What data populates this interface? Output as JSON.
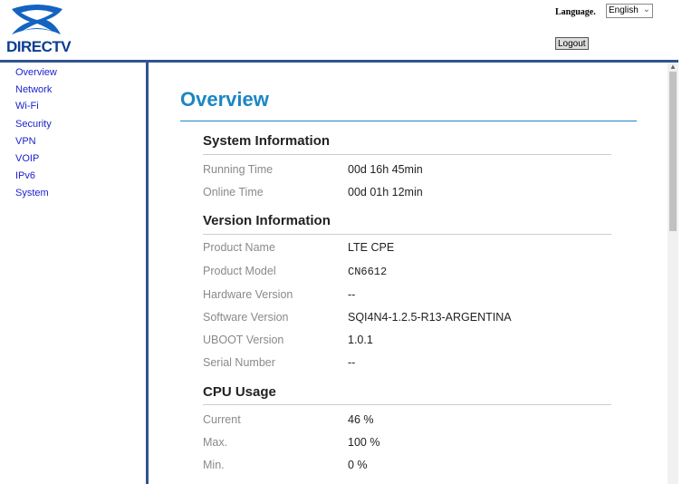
{
  "brand": {
    "logo_text": "DIRECTV"
  },
  "header": {
    "language_label": "Language.",
    "language_selected": "English",
    "logout_label": "Logout"
  },
  "sidebar": {
    "items": [
      {
        "label": "Overview"
      },
      {
        "label": "Network"
      },
      {
        "label": "Wi-Fi"
      },
      {
        "label": "Security"
      },
      {
        "label": "VPN"
      },
      {
        "label": "VOIP"
      },
      {
        "label": "IPv6"
      },
      {
        "label": "System"
      }
    ]
  },
  "main": {
    "title": "Overview",
    "sections": [
      {
        "title": "System Information",
        "rows": [
          {
            "label": "Running Time",
            "value": "00d 16h 45min"
          },
          {
            "label": "Online Time",
            "value": "00d 01h 12min"
          }
        ]
      },
      {
        "title": "Version Information",
        "rows": [
          {
            "label": "Product Name",
            "value": "LTE CPE"
          },
          {
            "label": "Product Model",
            "value": "CN6612"
          },
          {
            "label": "Hardware Version",
            "value": "--"
          },
          {
            "label": "Software Version",
            "value": "SQI4N4-1.2.5-R13-ARGENTINA"
          },
          {
            "label": "UBOOT Version",
            "value": "1.0.1"
          },
          {
            "label": "Serial Number",
            "value": "--"
          }
        ]
      },
      {
        "title": "CPU Usage",
        "rows": [
          {
            "label": "Current",
            "value": "46 %"
          },
          {
            "label": "Max.",
            "value": "100 %"
          },
          {
            "label": "Min.",
            "value": "0 %"
          }
        ]
      }
    ]
  },
  "colors": {
    "accent": "#1a86c4",
    "nav_bar": "#30548f",
    "link": "#1a1fcc"
  }
}
